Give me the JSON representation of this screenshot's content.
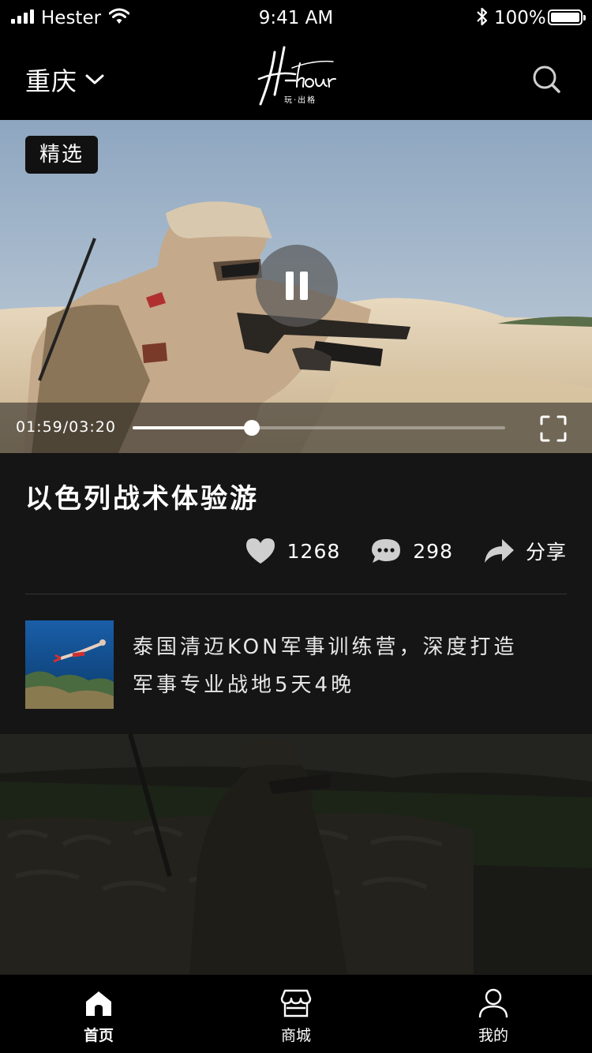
{
  "status_bar": {
    "carrier": "Hester",
    "time": "9:41 AM",
    "battery": "100%"
  },
  "nav": {
    "city": "重庆",
    "logo_text": "H-hour",
    "logo_sub": "玩·出格"
  },
  "video": {
    "badge": "精选",
    "time": "01:59/03:20",
    "progress": 0.32
  },
  "article": {
    "title": "以色列战术体验游",
    "likes": "1268",
    "comments": "298",
    "share_label": "分享"
  },
  "related": {
    "text": "泰国清迈KON军事训练营，深度打造军事专业战地5天4晚"
  },
  "tabbar": {
    "items": [
      {
        "label": "首页",
        "icon": "home-icon",
        "active": true
      },
      {
        "label": "商城",
        "icon": "store-icon",
        "active": false
      },
      {
        "label": "我的",
        "icon": "profile-icon",
        "active": false
      }
    ]
  },
  "colors": {
    "background": "#000000",
    "panel": "#151515",
    "icon_gray": "#cfcfcf"
  }
}
